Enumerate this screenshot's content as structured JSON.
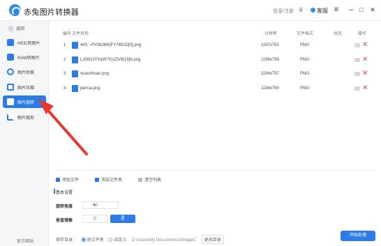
{
  "app": {
    "title": "赤兔图片转换器",
    "login": "登录/注册",
    "service": "客服"
  },
  "window": {
    "menu": "≡",
    "minimize": "–",
    "maximize": "□",
    "close": "✕"
  },
  "sidebar": {
    "back": "返回",
    "items": [
      {
        "label": "HEIC转图片",
        "icon_color": "#2f7be5"
      },
      {
        "label": "RAW转图片",
        "icon_color": "#2f7be5"
      },
      {
        "label": "图片转换",
        "icon_color": "#2f7be5"
      },
      {
        "label": "图片压缩",
        "icon_color": "#2f7be5"
      },
      {
        "label": "图片旋转",
        "icon_color": "#ffffff",
        "active": true
      },
      {
        "label": "图片裁剪",
        "icon_color": "#2f7be5"
      }
    ],
    "site": "官方网站"
  },
  "table": {
    "headers": {
      "index": "编号",
      "name": "文件名称",
      "resolution": "分辨率",
      "format": "文件格式",
      "status": "状态",
      "action": "操作"
    },
    "rows": [
      {
        "index": "1",
        "name": "44S`~PV38J6N}FY7851D[0].png",
        "resolution": "1197x762",
        "format": "PNG"
      },
      {
        "index": "2",
        "name": "LJ{W1JY%{W7X)1ZV9(15]8.png",
        "resolution": "1196x759",
        "format": "PNG"
      },
      {
        "index": "3",
        "name": "xuanzhuan.png",
        "resolution": "1194x757",
        "format": "PNG"
      },
      {
        "index": "4",
        "name": "jiancai.png",
        "resolution": "1194x760",
        "format": "PNG"
      }
    ]
  },
  "toolbar": {
    "add_file": "添加文件",
    "add_folder": "添加文件夹",
    "clear_list": "清空列表"
  },
  "settings": {
    "section_title": "基本设置",
    "rotate_label": "旋转角度",
    "rotate_value": "90",
    "mirror_label": "垂直镜像",
    "mirror_no": "否",
    "mirror_yes": "是"
  },
  "save": {
    "label": "保存目录：",
    "option_original": "原文件夹",
    "option_custom": "自定义",
    "path": "D:\\Users\\My Documents\\sfimageC",
    "change": "更改目录"
  },
  "start_button": "开始处理",
  "colors": {
    "accent": "#2f7be5",
    "delete": "#e64545",
    "arrow": "#e8392f"
  }
}
